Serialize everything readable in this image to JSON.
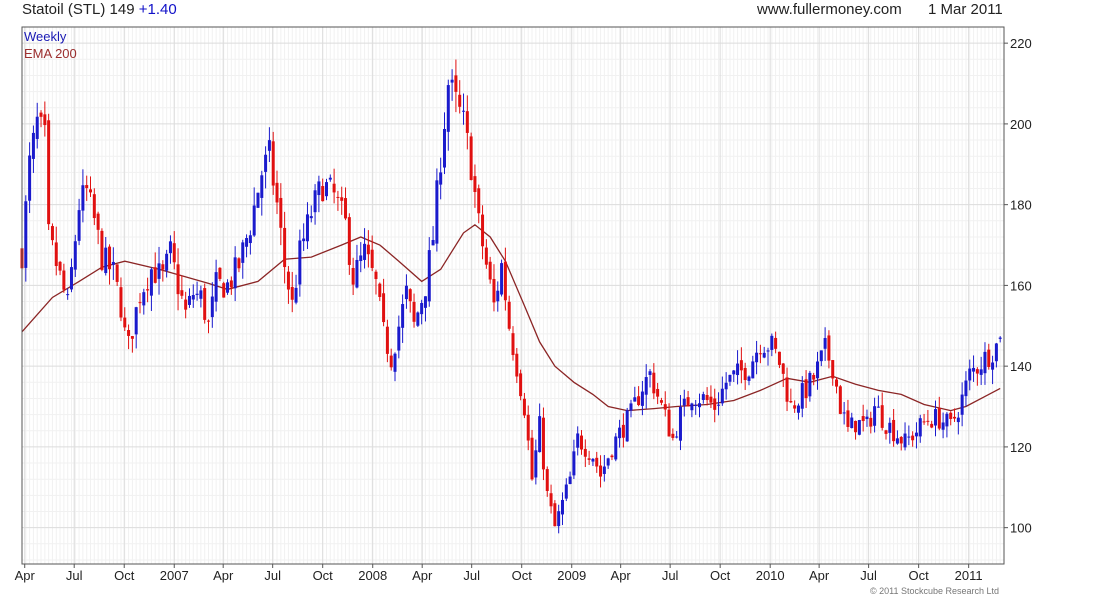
{
  "header": {
    "symbol": "Statoil (STL)",
    "price": "149",
    "change": "+1.40",
    "site": "www.fullermoney.com",
    "date": "1 Mar 2011"
  },
  "footer": {
    "copyright": "© 2011 Stockcube Research Ltd"
  },
  "colors": {
    "up": "#1a1acc",
    "down": "#e01010",
    "ema": "#8b2525",
    "grid": "#dcdcdc",
    "axis": "#555555"
  },
  "chart_data": {
    "type": "candlestick",
    "interval": "Weekly",
    "x_tick_labels": [
      "Apr",
      "Jul",
      "Oct",
      "2007",
      "Apr",
      "Jul",
      "Oct",
      "2008",
      "Apr",
      "Jul",
      "Oct",
      "2009",
      "Apr",
      "Jul",
      "Oct",
      "2010",
      "Apr",
      "Jul",
      "Oct",
      "2011"
    ],
    "y_ticks": [
      100,
      120,
      140,
      160,
      180,
      200,
      220
    ],
    "ylim": [
      91,
      224
    ],
    "xlim": [
      "2006-03-27",
      "2011-03-07"
    ],
    "grid": true,
    "y_axis_side": "right",
    "legend": {
      "position": "top-left",
      "entries": [
        "Weekly",
        "EMA 200"
      ]
    },
    "price_path": [
      [
        "2006-03-27",
        168
      ],
      [
        "2006-04-10",
        190
      ],
      [
        "2006-04-24",
        200
      ],
      [
        "2006-05-08",
        196
      ],
      [
        "2006-05-15",
        172
      ],
      [
        "2006-06-05",
        162
      ],
      [
        "2006-06-19",
        155
      ],
      [
        "2006-07-10",
        180
      ],
      [
        "2006-07-24",
        183
      ],
      [
        "2006-08-07",
        176
      ],
      [
        "2006-08-21",
        167
      ],
      [
        "2006-09-11",
        163
      ],
      [
        "2006-09-25",
        155
      ],
      [
        "2006-10-02",
        148
      ],
      [
        "2006-10-09",
        145
      ],
      [
        "2006-10-30",
        158
      ],
      [
        "2006-11-20",
        164
      ],
      [
        "2006-12-11",
        162
      ],
      [
        "2006-12-25",
        168
      ],
      [
        "2007-01-08",
        160
      ],
      [
        "2007-01-22",
        153
      ],
      [
        "2007-02-05",
        158
      ],
      [
        "2007-02-19",
        157
      ],
      [
        "2007-03-05",
        150
      ],
      [
        "2007-03-19",
        160
      ],
      [
        "2007-04-09",
        160
      ],
      [
        "2007-04-30",
        165
      ],
      [
        "2007-05-21",
        175
      ],
      [
        "2007-06-11",
        188
      ],
      [
        "2007-06-25",
        192
      ],
      [
        "2007-07-09",
        180
      ],
      [
        "2007-07-23",
        165
      ],
      [
        "2007-08-06",
        155
      ],
      [
        "2007-08-20",
        168
      ],
      [
        "2007-09-10",
        178
      ],
      [
        "2007-10-01",
        185
      ],
      [
        "2007-10-22",
        182
      ],
      [
        "2007-11-12",
        175
      ],
      [
        "2007-11-26",
        162
      ],
      [
        "2007-12-17",
        168
      ],
      [
        "2008-01-07",
        160
      ],
      [
        "2008-01-21",
        148
      ],
      [
        "2008-02-04",
        142
      ],
      [
        "2008-02-18",
        150
      ],
      [
        "2008-03-03",
        158
      ],
      [
        "2008-03-17",
        150
      ],
      [
        "2008-04-07",
        160
      ],
      [
        "2008-04-21",
        172
      ],
      [
        "2008-05-05",
        192
      ],
      [
        "2008-05-19",
        210
      ],
      [
        "2008-06-02",
        205
      ],
      [
        "2008-06-16",
        200
      ],
      [
        "2008-06-30",
        190
      ],
      [
        "2008-07-14",
        175
      ],
      [
        "2008-07-28",
        165
      ],
      [
        "2008-08-11",
        155
      ],
      [
        "2008-08-25",
        165
      ],
      [
        "2008-09-08",
        150
      ],
      [
        "2008-09-22",
        140
      ],
      [
        "2008-10-06",
        130
      ],
      [
        "2008-10-20",
        112
      ],
      [
        "2008-11-03",
        125
      ],
      [
        "2008-11-17",
        108
      ],
      [
        "2008-12-01",
        100
      ],
      [
        "2008-12-15",
        106
      ],
      [
        "2008-12-29",
        112
      ],
      [
        "2009-01-12",
        122
      ],
      [
        "2009-01-26",
        120
      ],
      [
        "2009-02-09",
        118
      ],
      [
        "2009-02-23",
        113
      ],
      [
        "2009-03-16",
        120
      ],
      [
        "2009-04-06",
        125
      ],
      [
        "2009-04-20",
        128
      ],
      [
        "2009-05-11",
        135
      ],
      [
        "2009-05-25",
        138
      ],
      [
        "2009-06-15",
        130
      ],
      [
        "2009-07-06",
        122
      ],
      [
        "2009-07-20",
        128
      ],
      [
        "2009-08-10",
        133
      ],
      [
        "2009-08-31",
        132
      ],
      [
        "2009-09-21",
        130
      ],
      [
        "2009-10-12",
        136
      ],
      [
        "2009-11-02",
        138
      ],
      [
        "2009-11-23",
        140
      ],
      [
        "2009-12-14",
        146
      ],
      [
        "2010-01-04",
        145
      ],
      [
        "2010-01-18",
        141
      ],
      [
        "2010-02-08",
        130
      ],
      [
        "2010-03-01",
        133
      ],
      [
        "2010-03-22",
        137
      ],
      [
        "2010-04-12",
        144
      ],
      [
        "2010-04-26",
        140
      ],
      [
        "2010-05-10",
        130
      ],
      [
        "2010-05-24",
        124
      ],
      [
        "2010-06-07",
        126
      ],
      [
        "2010-06-28",
        125
      ],
      [
        "2010-07-12",
        130
      ],
      [
        "2010-08-02",
        126
      ],
      [
        "2010-08-16",
        124
      ],
      [
        "2010-09-06",
        121
      ],
      [
        "2010-09-27",
        124
      ],
      [
        "2010-10-18",
        127
      ],
      [
        "2010-11-08",
        127
      ],
      [
        "2010-11-29",
        125
      ],
      [
        "2010-12-20",
        132
      ],
      [
        "2011-01-03",
        138
      ],
      [
        "2011-01-24",
        141
      ],
      [
        "2011-02-07",
        143
      ],
      [
        "2011-02-21",
        145
      ],
      [
        "2011-02-28",
        149
      ]
    ],
    "ema_200": [
      [
        "2006-03-27",
        148.5
      ],
      [
        "2006-05-22",
        157
      ],
      [
        "2006-07-10",
        161
      ],
      [
        "2006-08-21",
        164.5
      ],
      [
        "2006-10-02",
        166
      ],
      [
        "2006-12-04",
        164
      ],
      [
        "2007-03-05",
        160.5
      ],
      [
        "2007-04-09",
        159
      ],
      [
        "2007-06-04",
        161
      ],
      [
        "2007-07-23",
        166.5
      ],
      [
        "2007-09-10",
        167
      ],
      [
        "2007-11-05",
        170
      ],
      [
        "2007-12-10",
        172
      ],
      [
        "2008-01-14",
        170
      ],
      [
        "2008-02-18",
        166
      ],
      [
        "2008-03-31",
        161
      ],
      [
        "2008-05-05",
        164
      ],
      [
        "2008-06-16",
        173
      ],
      [
        "2008-07-07",
        175
      ],
      [
        "2008-08-04",
        172
      ],
      [
        "2008-09-01",
        166
      ],
      [
        "2008-10-06",
        155
      ],
      [
        "2008-11-03",
        146
      ],
      [
        "2008-12-01",
        140
      ],
      [
        "2009-01-05",
        136
      ],
      [
        "2009-02-09",
        133
      ],
      [
        "2009-03-09",
        130
      ],
      [
        "2009-04-13",
        129
      ],
      [
        "2009-06-01",
        129.5
      ],
      [
        "2009-07-13",
        130
      ],
      [
        "2009-09-07",
        130.5
      ],
      [
        "2009-10-26",
        131.5
      ],
      [
        "2009-12-14",
        134
      ],
      [
        "2010-02-01",
        137
      ],
      [
        "2010-03-15",
        136
      ],
      [
        "2010-04-26",
        137.5
      ],
      [
        "2010-06-07",
        135.5
      ],
      [
        "2010-07-19",
        134
      ],
      [
        "2010-08-30",
        133
      ],
      [
        "2010-10-11",
        130.5
      ],
      [
        "2010-11-29",
        129
      ],
      [
        "2010-12-27",
        130
      ],
      [
        "2011-01-31",
        132.5
      ],
      [
        "2011-02-28",
        134.5
      ]
    ]
  }
}
